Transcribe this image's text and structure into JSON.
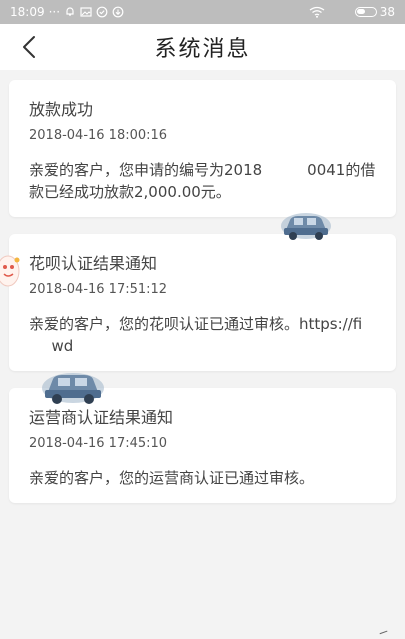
{
  "status_bar": {
    "time": "18:09",
    "dots": "···",
    "battery_level": "38"
  },
  "header": {
    "title": "系统消息"
  },
  "messages": [
    {
      "title": "放款成功",
      "time": "2018-04-16 18:00:16",
      "body": "亲爱的客户，您申请的编号为2018     0041的借款已经成功放款2,000.00元。"
    },
    {
      "title": "花呗认证结果通知",
      "time": "2018-04-16 17:51:12",
      "body": "亲爱的客户，您的花呗认证已通过审核。https://fi    wd"
    },
    {
      "title": "运营商认证结果通知",
      "time": "2018-04-16 17:45:10",
      "body": "亲爱的客户，您的运营商认证已通过审核。"
    }
  ],
  "colors": {
    "status_bar": "#bdbdbd",
    "background": "#f3f3f3",
    "card": "#ffffff",
    "text": "#444444"
  }
}
